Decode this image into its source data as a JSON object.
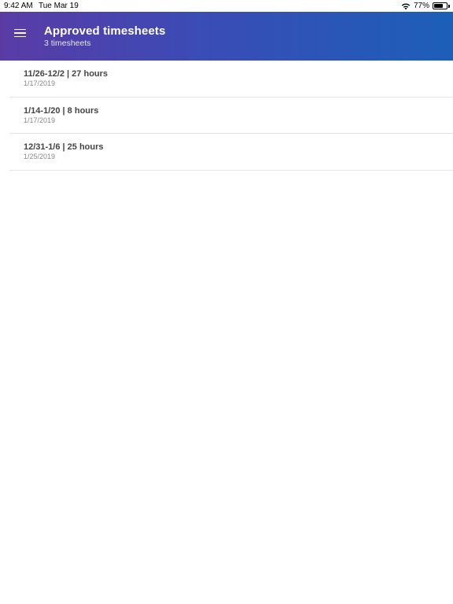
{
  "status_bar": {
    "time": "9:42 AM",
    "date": "Tue Mar 19",
    "battery": "77%"
  },
  "header": {
    "title": "Approved timesheets",
    "subtitle": "3 timesheets",
    "menu_icon": "hamburger-menu-icon"
  },
  "timesheets": [
    {
      "title": "11/26-12/2 | 27 hours",
      "date": "1/17/2019"
    },
    {
      "title": "1/14-1/20 | 8 hours",
      "date": "1/17/2019"
    },
    {
      "title": "12/31-1/6 | 25 hours",
      "date": "1/25/2019"
    }
  ],
  "colors": {
    "header_gradient_start": "#5a3ba6",
    "header_gradient_end": "#1c5fb8"
  }
}
